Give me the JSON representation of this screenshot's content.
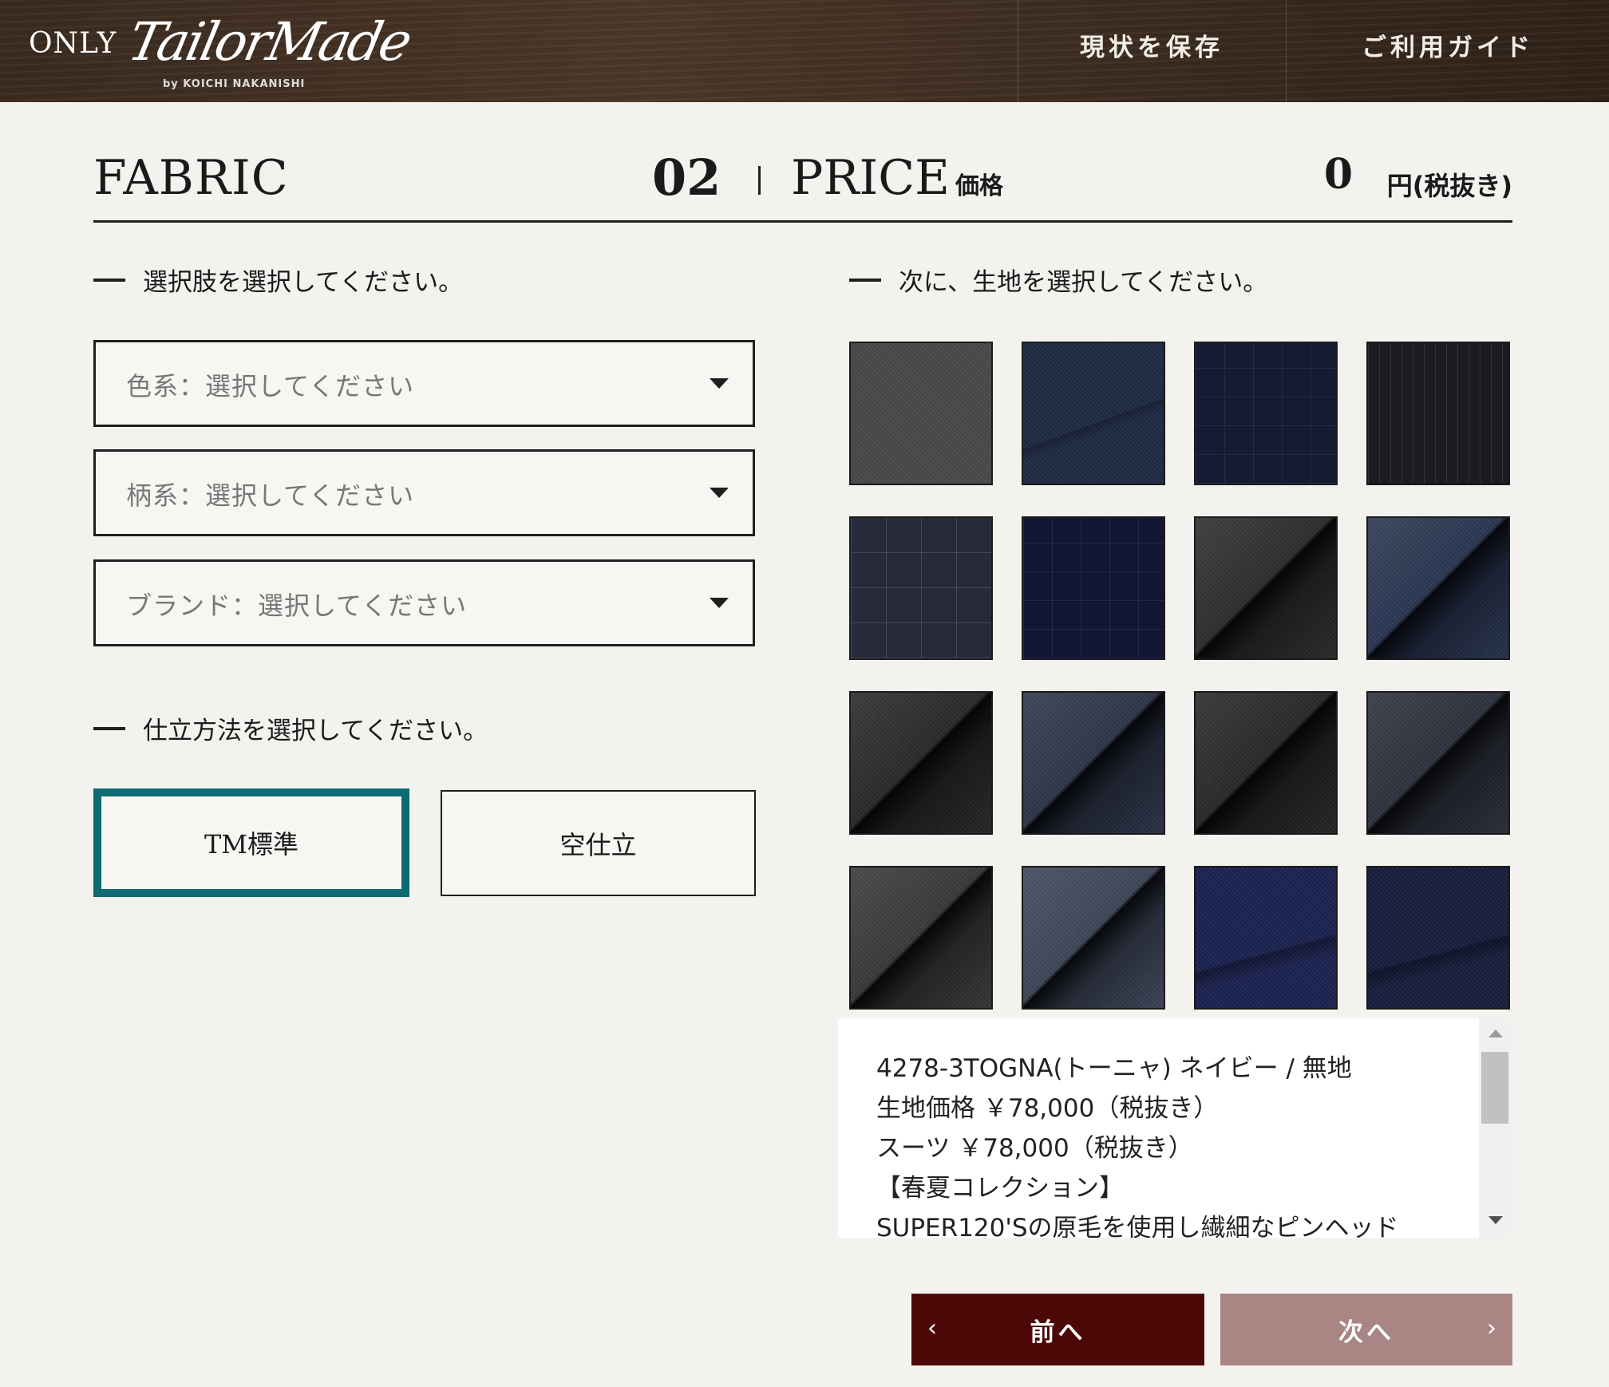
{
  "header": {
    "logo_only": "ONLY",
    "logo_script": "TailorMade",
    "logo_by": "by KOICHI NAKANISHI",
    "save_label": "現状を保存",
    "guide_label": "ご利用ガイド"
  },
  "title": {
    "section": "FABRIC",
    "step": "02",
    "price_label": "PRICE",
    "price_label_jp": "価格",
    "amount": "0",
    "unit": "円(税抜き)"
  },
  "left": {
    "filter_heading": "選択肢を選択してください。",
    "selects": [
      {
        "placeholder": "色系：選択してください"
      },
      {
        "placeholder": "柄系：選択してください"
      },
      {
        "placeholder": "ブランド：選択してください"
      }
    ],
    "tailoring_heading": "仕立方法を選択してください。",
    "tailoring_options": [
      {
        "label": "TM標準",
        "selected": true
      },
      {
        "label": "空仕立",
        "selected": false
      }
    ]
  },
  "right": {
    "fabric_heading": "次に、生地を選択してください。",
    "swatches": [
      {
        "color": "#4a4849"
      },
      {
        "color": "#1f2a44"
      },
      {
        "color": "#141c33"
      },
      {
        "color": "#1c1a22"
      },
      {
        "color": "#262a3a"
      },
      {
        "color": "#121633"
      },
      {
        "color": "#2a2a2c"
      },
      {
        "color": "#26324e"
      },
      {
        "color": "#262628"
      },
      {
        "color": "#2a3246"
      },
      {
        "color": "#252527"
      },
      {
        "color": "#2a2e3a"
      },
      {
        "color": "#363638"
      },
      {
        "color": "#3a4356"
      },
      {
        "color": "#1b2250"
      },
      {
        "color": "#171d3e"
      }
    ],
    "description_lines": [
      "4278-3TOGNA(トーニャ) ネイビー / 無地",
      "生地価格 ￥78,000（税抜き）",
      "スーツ ￥78,000（税抜き）",
      "【春夏コレクション】",
      "SUPER120'Sの原毛を使用し繊細なピンヘッド"
    ]
  },
  "nav": {
    "prev_label": "前へ",
    "next_label": "次へ",
    "prev_chevron": "‹",
    "next_chevron": "›"
  }
}
